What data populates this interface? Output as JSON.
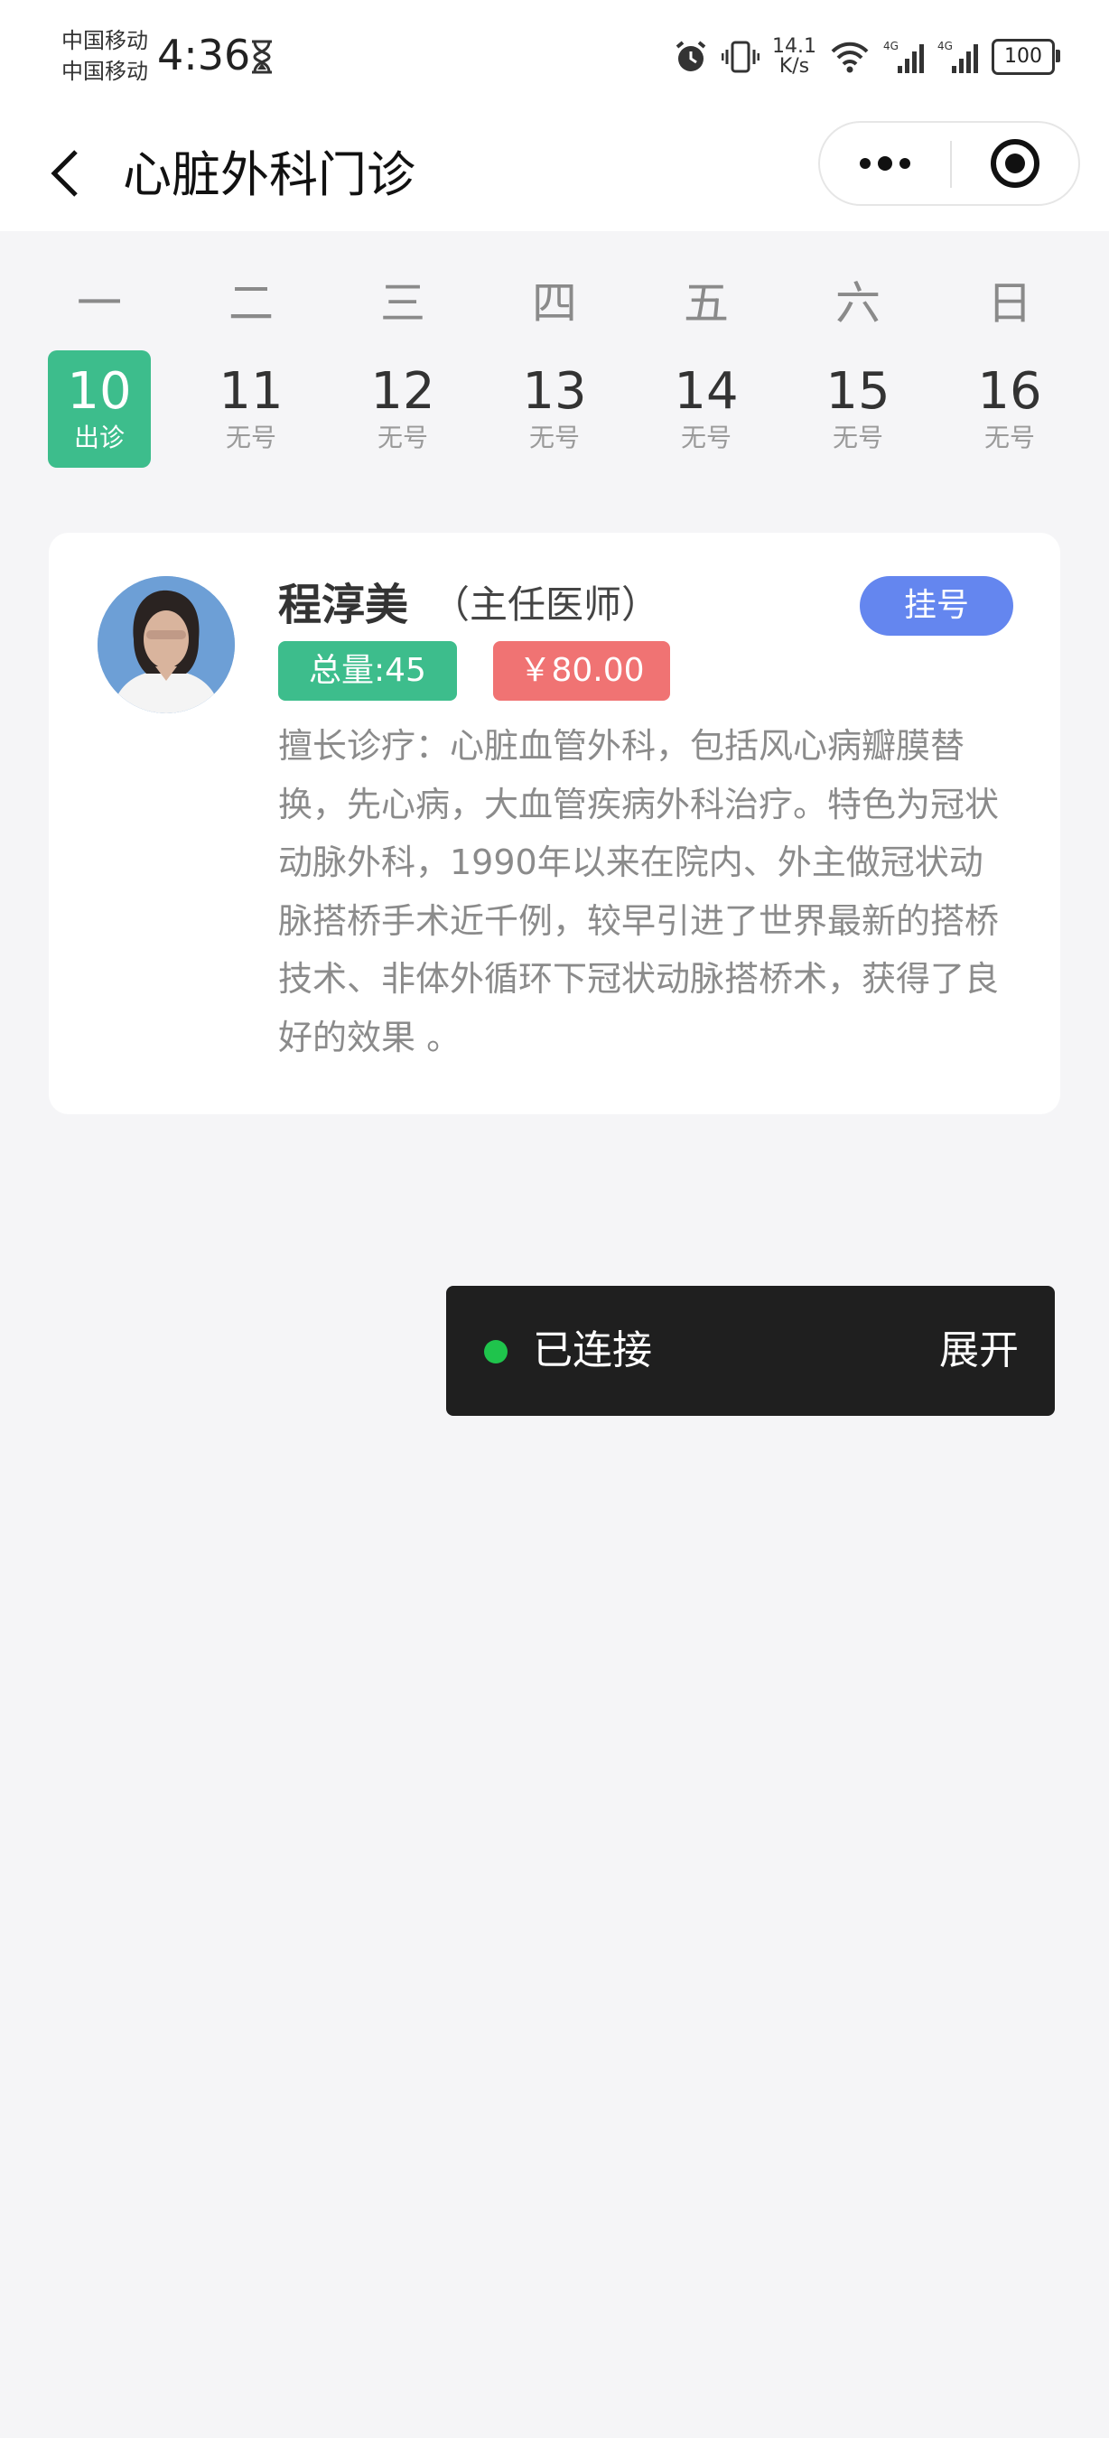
{
  "status_bar": {
    "carrier_1": "中国移动",
    "carrier_2": "中国移动",
    "time": "4:36",
    "net_speed_value": "14.1",
    "net_speed_unit": "K/s",
    "battery": "100",
    "icons": [
      "hourglass-icon",
      "alarm-icon",
      "vibrate-icon",
      "wifi-icon",
      "signal-4g-icon",
      "signal-4g-icon",
      "battery-icon"
    ]
  },
  "nav": {
    "title": "心脏外科门诊"
  },
  "calendar": {
    "weekdays": [
      "一",
      "二",
      "三",
      "四",
      "五",
      "六",
      "日"
    ],
    "dates": [
      {
        "day": "10",
        "status": "出诊",
        "selected": true
      },
      {
        "day": "11",
        "status": "无号",
        "selected": false
      },
      {
        "day": "12",
        "status": "无号",
        "selected": false
      },
      {
        "day": "13",
        "status": "无号",
        "selected": false
      },
      {
        "day": "14",
        "status": "无号",
        "selected": false
      },
      {
        "day": "15",
        "status": "无号",
        "selected": false
      },
      {
        "day": "16",
        "status": "无号",
        "selected": false
      }
    ]
  },
  "doctor": {
    "name": "程淳美",
    "title": "（主任医师）",
    "register_label": "挂号",
    "total_label": "总量:45",
    "price_label": "￥80.00",
    "specialty": "擅长诊疗：心脏血管外科，包括风心病瓣膜替换，先心病，大血管疾病外科治疗。特色为冠状动脉外科，1990年以来在院内、外主做冠状动脉搭桥手术近千例，较早引进了世界最新的搭桥技术、非体外循环下冠状动脉搭桥术，获得了良好的效果 。"
  },
  "toast": {
    "status": "已连接",
    "expand_label": "展开"
  },
  "colors": {
    "accent_green": "#3dbd8c",
    "accent_blue": "#6486ef",
    "price_red": "#f07373",
    "connected_dot": "#1fc44c"
  }
}
